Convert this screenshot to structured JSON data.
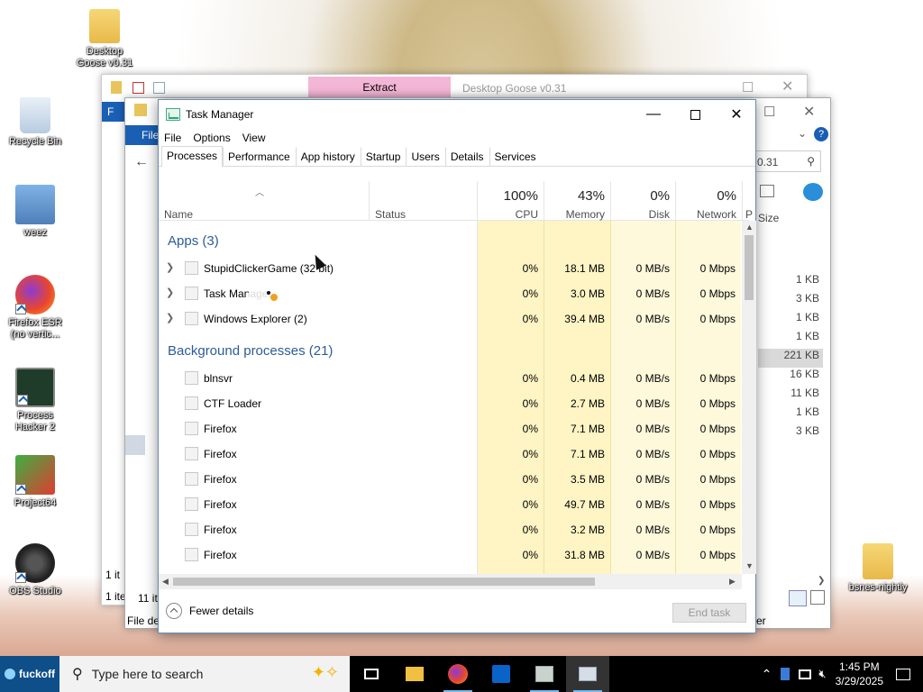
{
  "desktop": {
    "icons": [
      {
        "label": "Desktop Goose v0.31",
        "icon": "folder-icon"
      },
      {
        "label": "Recycle Bin",
        "icon": "recycle-bin-icon"
      },
      {
        "label": "weez",
        "icon": "image-icon"
      },
      {
        "label": "Firefox ESR (no vertic...",
        "icon": "firefox-icon"
      },
      {
        "label": "Process Hacker 2",
        "icon": "process-hacker-icon"
      },
      {
        "label": "Project64",
        "icon": "project64-icon"
      },
      {
        "label": "OBS Studio",
        "icon": "obs-icon"
      },
      {
        "label": "bsnes-nightly",
        "icon": "folder-icon"
      }
    ]
  },
  "bg_windows": {
    "goose_window": {
      "title": "Desktop Goose v0.31",
      "extract_tab": "Extract"
    },
    "explorer": {
      "menu_file_1": "F",
      "menu_file_2": "File",
      "search_text": "0.31",
      "size_header": "Size",
      "status_1": "1 it",
      "status_2": "11 it",
      "status_3": "1 ite",
      "status_4": "File de",
      "right_text": "er",
      "sizes": [
        "1 KB",
        "3 KB",
        "1 KB",
        "1 KB",
        "221 KB",
        "16 KB",
        "11 KB",
        "1 KB",
        "3 KB"
      ]
    }
  },
  "task_manager": {
    "title": "Task Manager",
    "menu": [
      "File",
      "Options",
      "View"
    ],
    "tabs": [
      "Processes",
      "Performance",
      "App history",
      "Startup",
      "Users",
      "Details",
      "Services"
    ],
    "active_tab": "Processes",
    "columns": {
      "name": "Name",
      "status": "Status",
      "cpu": {
        "pct": "100%",
        "label": "CPU"
      },
      "memory": {
        "pct": "43%",
        "label": "Memory"
      },
      "disk": {
        "pct": "0%",
        "label": "Disk"
      },
      "network": {
        "pct": "0%",
        "label": "Network"
      },
      "extra": "P"
    },
    "groups": {
      "apps": "Apps (3)",
      "background": "Background processes (21)"
    },
    "apps": [
      {
        "name": "StupidClickerGame (32 bit)",
        "cpu": "0%",
        "memory": "18.1 MB",
        "disk": "0 MB/s",
        "network": "0 Mbps"
      },
      {
        "name": "Task Manager",
        "cpu": "0%",
        "memory": "3.0 MB",
        "disk": "0 MB/s",
        "network": "0 Mbps"
      },
      {
        "name": "Windows Explorer (2)",
        "cpu": "0%",
        "memory": "39.4 MB",
        "disk": "0 MB/s",
        "network": "0 Mbps"
      }
    ],
    "background": [
      {
        "name": "blnsvr",
        "cpu": "0%",
        "memory": "0.4 MB",
        "disk": "0 MB/s",
        "network": "0 Mbps"
      },
      {
        "name": "CTF Loader",
        "cpu": "0%",
        "memory": "2.7 MB",
        "disk": "0 MB/s",
        "network": "0 Mbps"
      },
      {
        "name": "Firefox",
        "cpu": "0%",
        "memory": "7.1 MB",
        "disk": "0 MB/s",
        "network": "0 Mbps"
      },
      {
        "name": "Firefox",
        "cpu": "0%",
        "memory": "7.1 MB",
        "disk": "0 MB/s",
        "network": "0 Mbps"
      },
      {
        "name": "Firefox",
        "cpu": "0%",
        "memory": "3.5 MB",
        "disk": "0 MB/s",
        "network": "0 Mbps"
      },
      {
        "name": "Firefox",
        "cpu": "0%",
        "memory": "49.7 MB",
        "disk": "0 MB/s",
        "network": "0 Mbps"
      },
      {
        "name": "Firefox",
        "cpu": "0%",
        "memory": "3.2 MB",
        "disk": "0 MB/s",
        "network": "0 Mbps"
      },
      {
        "name": "Firefox",
        "cpu": "0%",
        "memory": "31.8 MB",
        "disk": "0 MB/s",
        "network": "0 Mbps"
      }
    ],
    "fewer_details": "Fewer details",
    "end_task": "End task"
  },
  "taskbar": {
    "start_label": "fuckoff",
    "search_placeholder": "Type here to search",
    "time": "1:45 PM",
    "date": "3/29/2025"
  }
}
